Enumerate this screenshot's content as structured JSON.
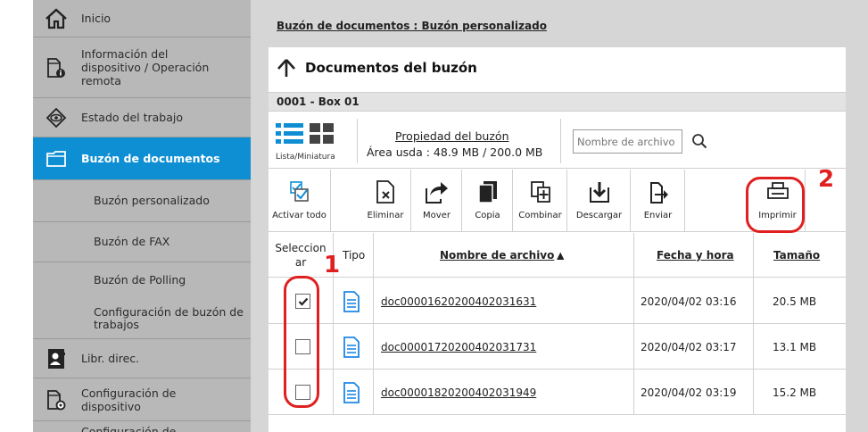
{
  "sidebar": {
    "items": [
      {
        "label": "Inicio",
        "icon": "home-icon"
      },
      {
        "label": "Información del dispositivo / Operación remota",
        "icon": "device-info-icon"
      },
      {
        "label": "Estado del trabajo",
        "icon": "eye-icon"
      },
      {
        "label": "Buzón de documentos",
        "icon": "folder-icon",
        "active": true
      },
      {
        "label": "Libr. direc.",
        "icon": "address-book-icon"
      },
      {
        "label": "Configuración de dispositivo",
        "icon": "device-settings-icon"
      },
      {
        "label": "Configuración de",
        "icon": "settings-icon"
      }
    ],
    "subitems": [
      {
        "label": "Buzón personalizado"
      },
      {
        "label": "Buzón de FAX"
      },
      {
        "label": "Buzón de Polling"
      },
      {
        "label": "Configuración de buzón de trabajos"
      }
    ]
  },
  "breadcrumb": "Buzón de documentos : Buzón personalizado",
  "panel": {
    "title": "Documentos del buzón",
    "box_name": "0001 - Box 01",
    "view_toggle_label": "Lista/Miniatura",
    "box_property_link": "Propiedad del buzón",
    "area_used": "Área usda : 48.9 MB / 200.0 MB",
    "search_placeholder": "Nombre de archivo"
  },
  "toolbar": {
    "select_all": "Activar todo",
    "delete": "Eliminar",
    "move": "Mover",
    "copy": "Copia",
    "merge": "Combinar",
    "download": "Descargar",
    "send": "Enviar",
    "print": "Imprimir"
  },
  "table": {
    "headers": {
      "select": "Seleccion ar",
      "type": "Tipo",
      "name": "Nombre de archivo",
      "date": "Fecha y hora",
      "size": "Tamaño"
    },
    "rows": [
      {
        "checked": true,
        "name": "doc00001620200402031631",
        "date": "2020/04/02 03:16",
        "size": "20.5 MB"
      },
      {
        "checked": false,
        "name": "doc00001720200402031731",
        "date": "2020/04/02 03:17",
        "size": "13.1 MB"
      },
      {
        "checked": false,
        "name": "doc00001820200402031949",
        "date": "2020/04/02 03:19",
        "size": "15.2 MB"
      }
    ]
  },
  "callouts": [
    "1",
    "2"
  ],
  "colors": {
    "accent": "#0e8fd3",
    "callout": "#e02020",
    "sidebar_bg": "#b8b8b8",
    "file_icon": "#1e88e5"
  }
}
